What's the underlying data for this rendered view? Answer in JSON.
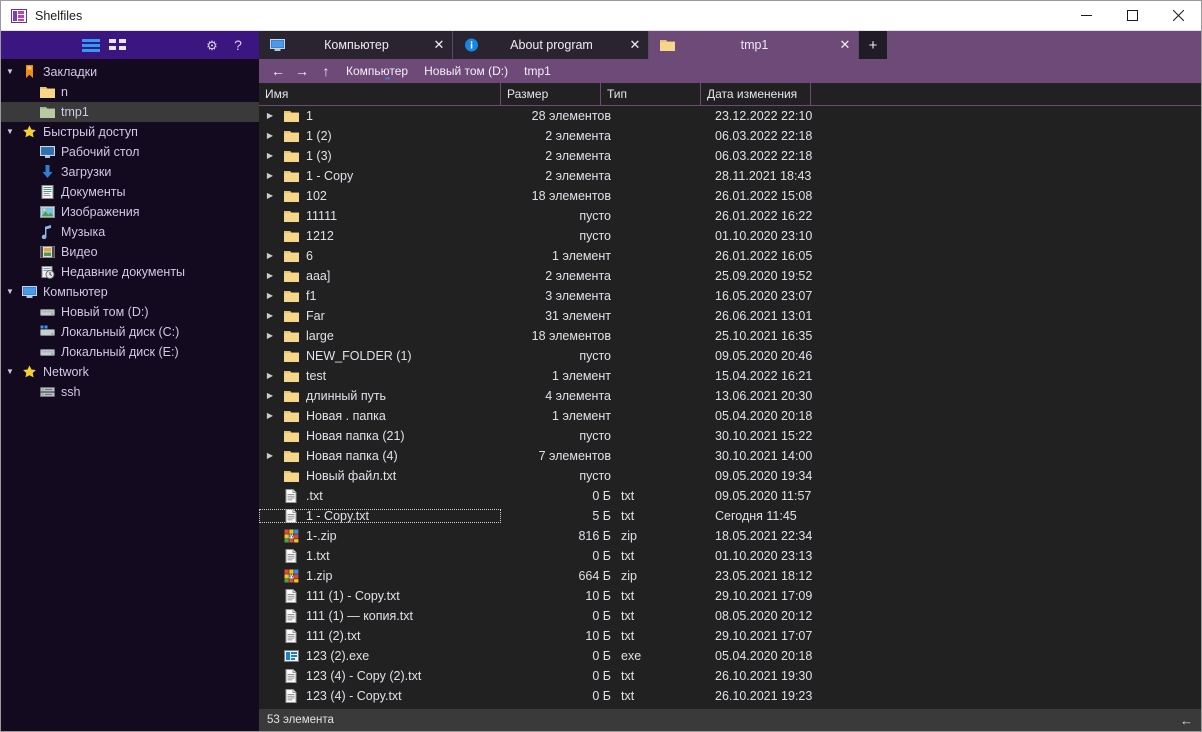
{
  "window": {
    "title": "Shelfiles",
    "app_icon": "shelfiles-logo-icon",
    "minimize_label": "–",
    "maximize_label": "☐",
    "close_label": "✕"
  },
  "sidebar": {
    "toolbar": {
      "list_view_icon": "list-view-icon",
      "grid_view_icon": "grid-view-icon",
      "settings_icon": "gear-icon",
      "help_label": "?"
    },
    "items": [
      {
        "label": "Закладки",
        "level": 1,
        "expander": "▼",
        "icon": "bookmark-icon",
        "selected": false
      },
      {
        "label": "n",
        "level": 2,
        "expander": "",
        "icon": "folder-yellow-icon",
        "selected": false
      },
      {
        "label": "tmp1",
        "level": 2,
        "expander": "",
        "icon": "folder-green-icon",
        "selected": true
      },
      {
        "label": "Быстрый доступ",
        "level": 1,
        "expander": "▼",
        "icon": "star-icon",
        "selected": false
      },
      {
        "label": "Рабочий стол",
        "level": 2,
        "expander": "",
        "icon": "desktop-icon",
        "selected": false
      },
      {
        "label": "Загрузки",
        "level": 2,
        "expander": "",
        "icon": "download-arrow-icon",
        "selected": false
      },
      {
        "label": "Документы",
        "level": 2,
        "expander": "",
        "icon": "documents-icon",
        "selected": false
      },
      {
        "label": "Изображения",
        "level": 2,
        "expander": "",
        "icon": "pictures-icon",
        "selected": false
      },
      {
        "label": "Музыка",
        "level": 2,
        "expander": "",
        "icon": "music-note-icon",
        "selected": false
      },
      {
        "label": "Видео",
        "level": 2,
        "expander": "",
        "icon": "video-icon",
        "selected": false
      },
      {
        "label": "Недавние документы",
        "level": 2,
        "expander": "",
        "icon": "recent-documents-icon",
        "selected": false
      },
      {
        "label": "Компьютер",
        "level": 1,
        "expander": "▼",
        "icon": "computer-icon",
        "selected": false
      },
      {
        "label": "Новый том (D:)",
        "level": 2,
        "expander": "",
        "icon": "drive-icon",
        "selected": false
      },
      {
        "label": "Локальный диск (C:)",
        "level": 2,
        "expander": "",
        "icon": "system-drive-icon",
        "selected": false
      },
      {
        "label": "Локальный диск (E:)",
        "level": 2,
        "expander": "",
        "icon": "drive-icon",
        "selected": false
      },
      {
        "label": "Network",
        "level": 1,
        "expander": "▼",
        "icon": "star-icon",
        "selected": false
      },
      {
        "label": "ssh",
        "level": 2,
        "expander": "",
        "icon": "server-icon",
        "selected": false
      }
    ]
  },
  "tabs": [
    {
      "label": "Компьютер",
      "icon": "computer-icon",
      "close_label": "✕",
      "active": false
    },
    {
      "label": "About program",
      "icon": "info-icon",
      "close_label": "✕",
      "active": false
    },
    {
      "label": "tmp1",
      "icon": "folder-yellow-icon",
      "close_label": "✕",
      "active": true
    }
  ],
  "new_tab_label": "+",
  "breadcrumb": {
    "back_label": "←",
    "forward_label": "→",
    "up_label": "↑",
    "parts": [
      "Компьютер",
      "Новый том (D:)",
      "tmp1"
    ]
  },
  "columns": {
    "name": "Имя",
    "size": "Размер",
    "type": "Тип",
    "date": "Дата изменения",
    "sort_indicator": "⌃",
    "sorted_by": "name",
    "sort_direction": "asc"
  },
  "files": [
    {
      "name": "1",
      "size": "28 элементов",
      "type": "",
      "date": "23.12.2022 22:10",
      "icon": "folder-yellow-icon",
      "expandable": true,
      "focused": false
    },
    {
      "name": "1 (2)",
      "size": "2 элемента",
      "type": "",
      "date": "06.03.2022 22:18",
      "icon": "folder-yellow-icon",
      "expandable": true,
      "focused": false
    },
    {
      "name": "1 (3)",
      "size": "2 элемента",
      "type": "",
      "date": "06.03.2022 22:18",
      "icon": "folder-yellow-icon",
      "expandable": true,
      "focused": false
    },
    {
      "name": "1 - Copy",
      "size": "2 элемента",
      "type": "",
      "date": "28.11.2021 18:43",
      "icon": "folder-yellow-icon",
      "expandable": true,
      "focused": false
    },
    {
      "name": "102",
      "size": "18 элементов",
      "type": "",
      "date": "26.01.2022 15:08",
      "icon": "folder-yellow-icon",
      "expandable": true,
      "focused": false
    },
    {
      "name": "11111",
      "size": "пусто",
      "type": "",
      "date": "26.01.2022 16:22",
      "icon": "folder-yellow-icon",
      "expandable": false,
      "focused": false
    },
    {
      "name": "1212",
      "size": "пусто",
      "type": "",
      "date": "01.10.2020 23:10",
      "icon": "folder-yellow-icon",
      "expandable": false,
      "focused": false
    },
    {
      "name": "6",
      "size": "1 элемент",
      "type": "",
      "date": "26.01.2022 16:05",
      "icon": "folder-yellow-icon",
      "expandable": true,
      "focused": false
    },
    {
      "name": "aaa]",
      "size": "2 элемента",
      "type": "",
      "date": "25.09.2020 19:52",
      "icon": "folder-yellow-icon",
      "expandable": true,
      "focused": false
    },
    {
      "name": "f1",
      "size": "3 элемента",
      "type": "",
      "date": "16.05.2020 23:07",
      "icon": "folder-yellow-icon",
      "expandable": true,
      "focused": false
    },
    {
      "name": "Far",
      "size": "31 элемент",
      "type": "",
      "date": "26.06.2021 13:01",
      "icon": "folder-yellow-icon",
      "expandable": true,
      "focused": false
    },
    {
      "name": "large",
      "size": "18 элементов",
      "type": "",
      "date": "25.10.2021 16:35",
      "icon": "folder-yellow-icon",
      "expandable": true,
      "focused": false
    },
    {
      "name": "NEW_FOLDER (1)",
      "size": "пусто",
      "type": "",
      "date": "09.05.2020 20:46",
      "icon": "folder-yellow-icon",
      "expandable": false,
      "focused": false
    },
    {
      "name": "test",
      "size": "1 элемент",
      "type": "",
      "date": "15.04.2022 16:21",
      "icon": "folder-yellow-icon",
      "expandable": true,
      "focused": false
    },
    {
      "name": "длинный путь",
      "size": "4 элемента",
      "type": "",
      "date": "13.06.2021 20:30",
      "icon": "folder-yellow-icon",
      "expandable": true,
      "focused": false
    },
    {
      "name": "Новая . папка",
      "size": "1 элемент",
      "type": "",
      "date": "05.04.2020 20:18",
      "icon": "folder-yellow-icon",
      "expandable": true,
      "focused": false
    },
    {
      "name": "Новая папка (21)",
      "size": "пусто",
      "type": "",
      "date": "30.10.2021 15:22",
      "icon": "folder-yellow-icon",
      "expandable": false,
      "focused": false
    },
    {
      "name": "Новая папка (4)",
      "size": "7 элементов",
      "type": "",
      "date": "30.10.2021 14:00",
      "icon": "folder-yellow-icon",
      "expandable": true,
      "focused": false
    },
    {
      "name": "Новый файл.txt",
      "size": "пусто",
      "type": "",
      "date": "09.05.2020 19:34",
      "icon": "folder-yellow-icon",
      "expandable": false,
      "focused": false
    },
    {
      "name": ".txt",
      "size": "0 Б",
      "type": "txt",
      "date": "09.05.2020 11:57",
      "icon": "text-file-icon",
      "expandable": false,
      "focused": false
    },
    {
      "name": "1 - Copy.txt",
      "size": "5 Б",
      "type": "txt",
      "date": "Сегодня 11:45",
      "icon": "text-file-icon",
      "expandable": false,
      "focused": true
    },
    {
      "name": "1-.zip",
      "size": "816 Б",
      "type": "zip",
      "date": "18.05.2021 22:34",
      "icon": "archive-file-icon",
      "expandable": false,
      "focused": false
    },
    {
      "name": "1.txt",
      "size": "0 Б",
      "type": "txt",
      "date": "01.10.2020 23:13",
      "icon": "text-file-icon",
      "expandable": false,
      "focused": false
    },
    {
      "name": "1.zip",
      "size": "664 Б",
      "type": "zip",
      "date": "23.05.2021 18:12",
      "icon": "archive-file-icon",
      "expandable": false,
      "focused": false
    },
    {
      "name": "111 (1) - Copy.txt",
      "size": "10 Б",
      "type": "txt",
      "date": "29.10.2021 17:09",
      "icon": "text-file-icon",
      "expandable": false,
      "focused": false
    },
    {
      "name": "111 (1) — копия.txt",
      "size": "0 Б",
      "type": "txt",
      "date": "08.05.2020 20:12",
      "icon": "text-file-icon",
      "expandable": false,
      "focused": false
    },
    {
      "name": "111 (2).txt",
      "size": "10 Б",
      "type": "txt",
      "date": "29.10.2021 17:07",
      "icon": "text-file-icon",
      "expandable": false,
      "focused": false
    },
    {
      "name": "123 (2).exe",
      "size": "0 Б",
      "type": "exe",
      "date": "05.04.2020 20:18",
      "icon": "executable-file-icon",
      "expandable": false,
      "focused": false
    },
    {
      "name": "123 (4) - Copy (2).txt",
      "size": "0 Б",
      "type": "txt",
      "date": "26.10.2021 19:30",
      "icon": "text-file-icon",
      "expandable": false,
      "focused": false
    },
    {
      "name": "123 (4) - Copy.txt",
      "size": "0 Б",
      "type": "txt",
      "date": "26.10.2021 19:23",
      "icon": "text-file-icon",
      "expandable": false,
      "focused": false
    }
  ],
  "status": {
    "text": "53 элемента",
    "right_arrow": "←"
  },
  "colors": {
    "accent_purple": "#3b1580",
    "tab_active": "#6d4a78",
    "sidebar_bg": "#130a20",
    "list_bg": "#212121",
    "sort_blue": "#2f9bf5",
    "folder_yellow": "#f2d06b",
    "status_bg": "#3a3a3a"
  }
}
